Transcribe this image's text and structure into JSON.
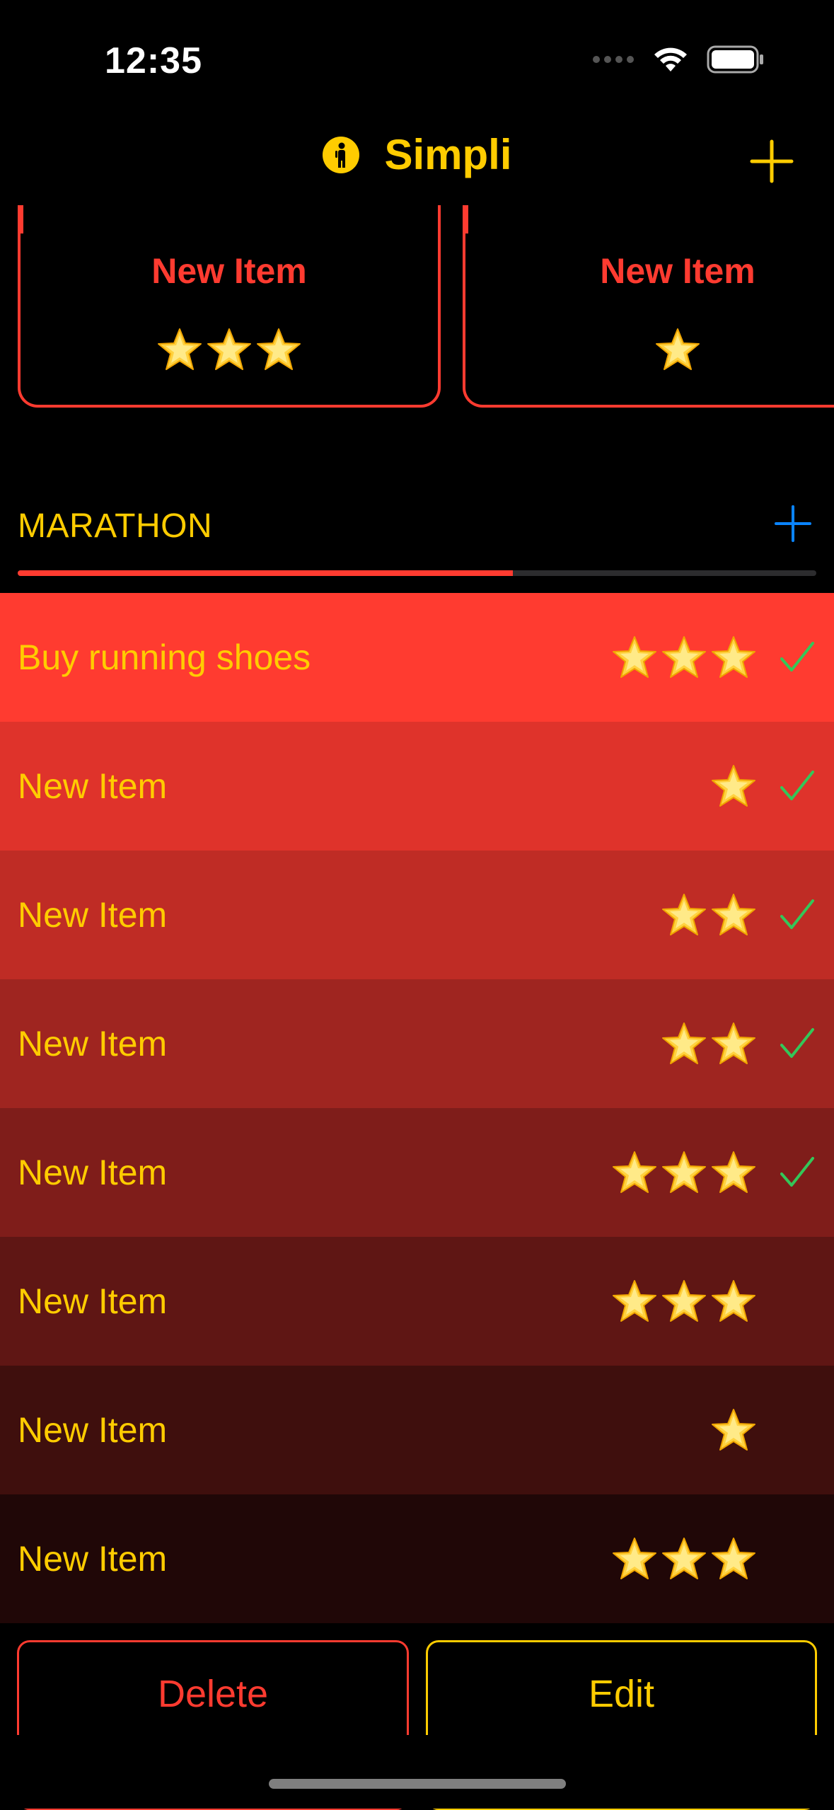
{
  "status_bar": {
    "time": "12:35",
    "icons": [
      "signal-dots-icon",
      "wifi-icon",
      "battery-icon"
    ]
  },
  "nav": {
    "title": "Simpli",
    "logo_icon": "walking-person-icon",
    "add_icon": "plus-icon"
  },
  "cards": [
    {
      "title": "New Item",
      "stars": 3
    },
    {
      "title": "New Item",
      "stars": 1
    }
  ],
  "section": {
    "title": "MARATHON",
    "add_icon": "plus-icon",
    "progress": 0.62
  },
  "list": [
    {
      "label": "Buy running shoes",
      "stars": 3,
      "done": true,
      "bg": "#ff3b30"
    },
    {
      "label": "New Item",
      "stars": 1,
      "done": true,
      "bg": "#df332b"
    },
    {
      "label": "New Item",
      "stars": 2,
      "done": true,
      "bg": "#bf2c25"
    },
    {
      "label": "New Item",
      "stars": 2,
      "done": true,
      "bg": "#9f2520"
    },
    {
      "label": "New Item",
      "stars": 3,
      "done": true,
      "bg": "#7f1d1a"
    },
    {
      "label": "New Item",
      "stars": 3,
      "done": false,
      "bg": "#5f1614"
    },
    {
      "label": "New Item",
      "stars": 1,
      "done": false,
      "bg": "#3f0f0d"
    },
    {
      "label": "New Item",
      "stars": 3,
      "done": false,
      "bg": "#200707"
    }
  ],
  "actions": {
    "delete_label": "Delete",
    "edit_label": "Edit"
  },
  "colors": {
    "accent": "#ffcc00",
    "red": "#ff3b30",
    "check": "#34c759",
    "link": "#0a84ff"
  }
}
